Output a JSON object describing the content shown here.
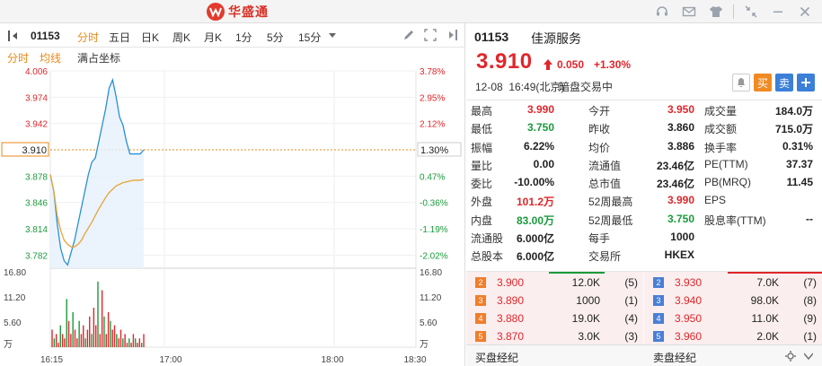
{
  "app": {
    "brand": "华盛通",
    "brand_mark": "W"
  },
  "window_buttons": [
    {
      "name": "headset-icon"
    },
    {
      "name": "mail-icon"
    },
    {
      "name": "skin-icon"
    },
    {
      "name": "shrink-icon"
    },
    {
      "name": "minimize-icon"
    },
    {
      "name": "close-icon"
    }
  ],
  "toolbar": {
    "code": "01153",
    "tabs": [
      "分时",
      "五日",
      "日K",
      "周K",
      "月K",
      "1分",
      "5分",
      "15分"
    ],
    "active_tab": 0
  },
  "subtabs": {
    "minute": "分时",
    "avg": "均线",
    "fullcoord": "满占坐标"
  },
  "chart_data": {
    "type": "line",
    "title": "",
    "price_axis_left": [
      "4.006",
      "3.974",
      "3.942",
      "3.910",
      "3.878",
      "3.846",
      "3.814",
      "3.782"
    ],
    "pct_axis_right": [
      "3.78%",
      "2.95%",
      "2.12%",
      "1.30%",
      "0.47%",
      "-0.36%",
      "-1.19%",
      "-2.02%"
    ],
    "volume_axis_left": [
      "16.80",
      "11.20",
      "5.60",
      "万"
    ],
    "volume_axis_right": [
      "16.80",
      "11.20",
      "5.60",
      "万"
    ],
    "x_ticks": [
      "16:15",
      "17:00",
      "18:00",
      "18:30"
    ],
    "ylim": [
      3.766,
      4.006
    ],
    "prev_close_line": 3.91,
    "current_label_left": "3.910",
    "current_label_right": "1.30%",
    "series": [
      {
        "name": "",
        "values": [
          3.88,
          3.86,
          3.82,
          3.79,
          3.775,
          3.77,
          3.785,
          3.8,
          3.82,
          3.84,
          3.86,
          3.88,
          3.895,
          3.9,
          3.92,
          3.94,
          3.96,
          3.985,
          3.995,
          3.975,
          3.95,
          3.94,
          3.92,
          3.905,
          3.905,
          3.905,
          3.905,
          3.91
        ]
      },
      {
        "name": "",
        "values": [
          3.88,
          3.86,
          3.83,
          3.812,
          3.8,
          3.795,
          3.792,
          3.792,
          3.795,
          3.8,
          3.808,
          3.815,
          3.822,
          3.83,
          3.838,
          3.845,
          3.852,
          3.858,
          3.862,
          3.866,
          3.868,
          3.87,
          3.871,
          3.872,
          3.873,
          3.873,
          3.873,
          3.874
        ]
      }
    ],
    "volume": [
      4,
      2,
      3,
      1,
      5,
      3,
      2,
      11,
      6,
      3,
      8,
      4,
      2,
      6,
      3,
      5,
      2,
      4,
      7,
      3,
      9,
      5,
      15,
      3,
      13,
      7,
      3,
      8,
      6,
      4,
      5,
      3,
      2,
      4,
      2,
      3,
      1,
      2,
      1,
      3,
      2,
      1,
      2,
      1,
      3
    ]
  },
  "quote": {
    "code": "01153",
    "name": "佳源服务",
    "price": "3.910",
    "change": "0.050",
    "change_pct": "+1.30%",
    "date": "12-08",
    "time": "16:49(北京)",
    "session": "暗盘交易中",
    "buy_label": "买",
    "sell_label": "卖"
  },
  "stats": [
    [
      {
        "l": "最高",
        "v": "3.990",
        "c": "red"
      },
      {
        "l": "今开",
        "v": "3.950",
        "c": "red"
      },
      {
        "l": "成交量",
        "v": "184.0万",
        "c": "blk"
      }
    ],
    [
      {
        "l": "最低",
        "v": "3.750",
        "c": "green"
      },
      {
        "l": "昨收",
        "v": "3.860",
        "c": "blk"
      },
      {
        "l": "成交额",
        "v": "715.0万",
        "c": "blk"
      }
    ],
    [
      {
        "l": "振幅",
        "v": "6.22%",
        "c": "blk"
      },
      {
        "l": "均价",
        "v": "3.886",
        "c": "blk"
      },
      {
        "l": "换手率",
        "v": "0.31%",
        "c": "blk"
      }
    ],
    [
      {
        "l": "量比",
        "v": "0.00",
        "c": "blk"
      },
      {
        "l": "流通值",
        "v": "23.46亿",
        "c": "blk"
      },
      {
        "l": "PE(TTM)",
        "v": "37.37",
        "c": "blk"
      }
    ],
    [
      {
        "l": "委比",
        "v": "-10.00%",
        "c": "blk"
      },
      {
        "l": "总市值",
        "v": "23.46亿",
        "c": "blk"
      },
      {
        "l": "PB(MRQ)",
        "v": "11.45",
        "c": "blk"
      }
    ],
    [
      {
        "l": "外盘",
        "v": "101.2万",
        "c": "red"
      },
      {
        "l": "52周最高",
        "v": "3.990",
        "c": "red"
      },
      {
        "l": "EPS",
        "v": "",
        "c": "blk"
      }
    ],
    [
      {
        "l": "内盘",
        "v": "83.00万",
        "c": "green"
      },
      {
        "l": "52周最低",
        "v": "3.750",
        "c": "green"
      },
      {
        "l": "股息率(TTM)",
        "v": "--",
        "c": "blk"
      }
    ],
    [
      {
        "l": "流通股",
        "v": "6.000亿",
        "c": "blk"
      },
      {
        "l": "每手",
        "v": "1000",
        "c": "blk"
      },
      {
        "l": "",
        "v": "",
        "c": "blk"
      }
    ],
    [
      {
        "l": "总股本",
        "v": "6.000亿",
        "c": "blk"
      },
      {
        "l": "交易所",
        "v": "HKEX",
        "c": "blk"
      },
      {
        "l": "",
        "v": "",
        "c": "blk"
      }
    ]
  ],
  "bids": [
    {
      "idx": "2",
      "price": "3.900",
      "vol": "12.0K",
      "cnt": "(5)"
    },
    {
      "idx": "3",
      "price": "3.890",
      "vol": "1000",
      "cnt": "(1)"
    },
    {
      "idx": "4",
      "price": "3.880",
      "vol": "19.0K",
      "cnt": "(4)"
    },
    {
      "idx": "5",
      "price": "3.870",
      "vol": "3.0K",
      "cnt": "(3)"
    }
  ],
  "asks": [
    {
      "idx": "2",
      "price": "3.930",
      "vol": "7.0K",
      "cnt": "(7)"
    },
    {
      "idx": "3",
      "price": "3.940",
      "vol": "98.0K",
      "cnt": "(8)"
    },
    {
      "idx": "4",
      "price": "3.950",
      "vol": "11.0K",
      "cnt": "(9)"
    },
    {
      "idx": "5",
      "price": "3.960",
      "vol": "2.0K",
      "cnt": "(1)"
    }
  ],
  "broker": {
    "buy": "买盘经纪",
    "sell": "卖盘经纪"
  },
  "colors": {
    "up": "#e0262b",
    "down": "#1a9a3c",
    "accent": "#e8891a",
    "price_line": "#2a8fd6",
    "avg_line": "#e8a33a"
  }
}
